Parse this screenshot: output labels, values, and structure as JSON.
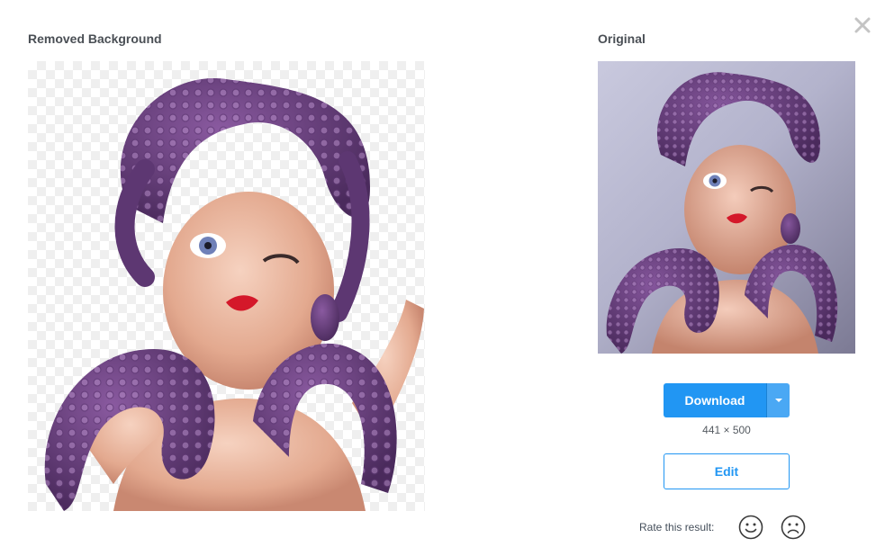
{
  "left_panel": {
    "heading": "Removed Background"
  },
  "right_panel": {
    "heading": "Original"
  },
  "close": {
    "icon": "close-icon"
  },
  "actions": {
    "download_label": "Download",
    "download_menu_icon": "caret-down-icon",
    "dimensions": "441 × 500",
    "edit_label": "Edit"
  },
  "rating": {
    "label": "Rate this result:",
    "positive_icon": "smiley-happy-icon",
    "negative_icon": "smiley-sad-icon"
  },
  "colors": {
    "primary": "#2196f3",
    "primary_light": "#4aa8f4",
    "tentacle": "#6a3f7e",
    "sucker": "#b48bc6",
    "skin": "#e9b7a0"
  }
}
